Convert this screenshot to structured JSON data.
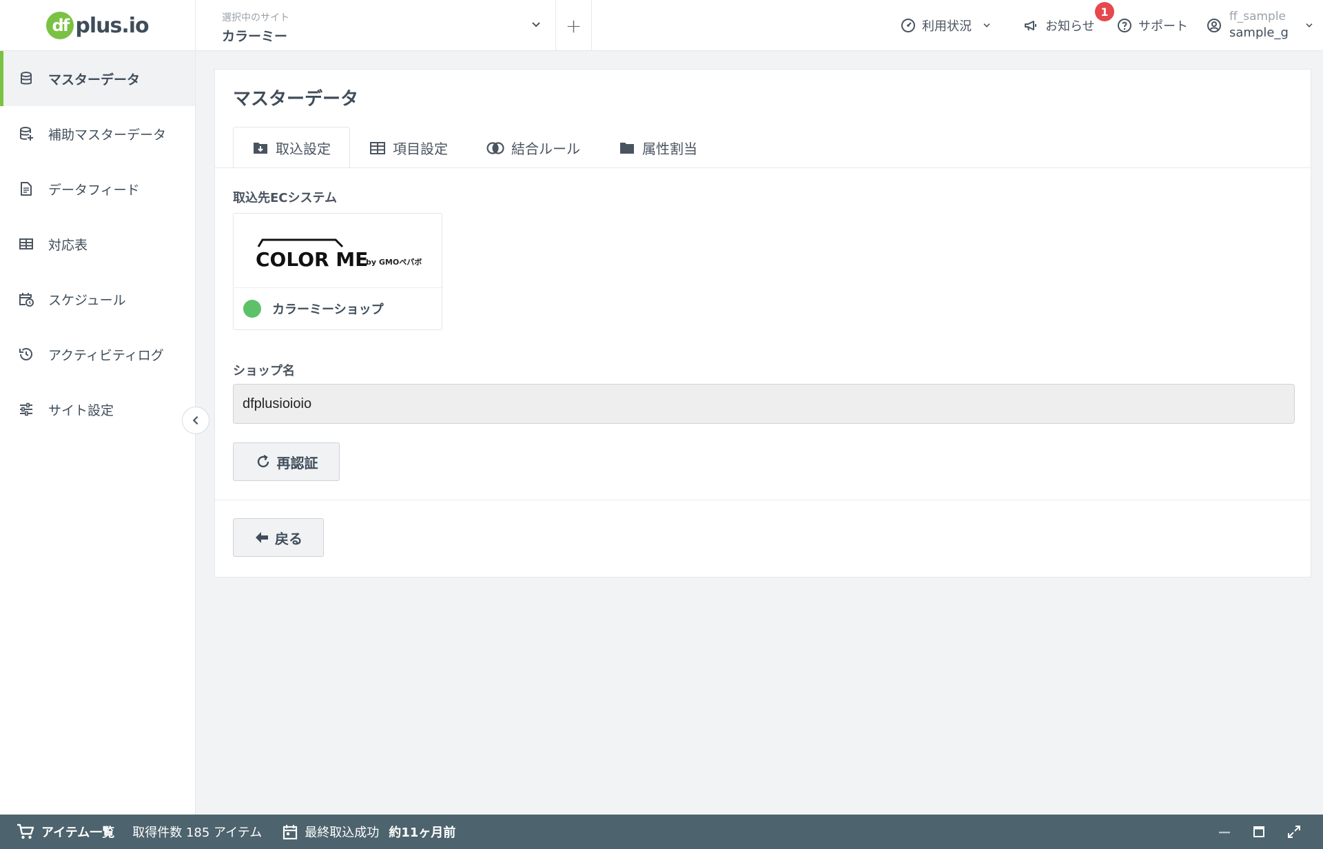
{
  "header": {
    "logo_mark": "df",
    "logo_text": "plus.io",
    "site_select_label": "選択中のサイト",
    "site_name": "カラーミー",
    "add_label": "+",
    "usage_label": "利用状況",
    "news_label": "お知らせ",
    "news_badge": "1",
    "support_label": "サポート",
    "user_id": "ff_sample",
    "user_name": "sample_g"
  },
  "sidebar": {
    "items": [
      {
        "label": "マスターデータ",
        "icon": "database-icon"
      },
      {
        "label": "補助マスターデータ",
        "icon": "database-plus-icon"
      },
      {
        "label": "データフィード",
        "icon": "file-list-icon"
      },
      {
        "label": "対応表",
        "icon": "table-icon"
      },
      {
        "label": "スケジュール",
        "icon": "calendar-clock-icon"
      },
      {
        "label": "アクティビティログ",
        "icon": "history-icon"
      },
      {
        "label": "サイト設定",
        "icon": "sliders-icon"
      }
    ]
  },
  "main": {
    "title": "マスターデータ",
    "tabs": [
      {
        "label": "取込設定",
        "icon": "folder-download-icon"
      },
      {
        "label": "項目設定",
        "icon": "table-icon"
      },
      {
        "label": "結合ルール",
        "icon": "merge-icon"
      },
      {
        "label": "属性割当",
        "icon": "folder-icon"
      }
    ],
    "ec_system_label": "取込先ECシステム",
    "ec_logo_text": "COLOR ME",
    "ec_logo_sub": "by GMOペパボ",
    "ec_shop_name": "カラーミーショップ",
    "shop_name_label": "ショップ名",
    "shop_name_value": "dfplusioioio",
    "reauth_label": "再認証",
    "back_label": "戻る"
  },
  "footer": {
    "item_list_label": "アイテム一覧",
    "count_text": "取得件数 185 アイテム",
    "last_import_label": "最終取込成功",
    "last_import_value": "約11ヶ月前"
  },
  "colors": {
    "accent_green": "#7bc144",
    "status_green": "#5dc16a",
    "badge_red": "#e5484d",
    "footer_bg": "#4d636d"
  }
}
